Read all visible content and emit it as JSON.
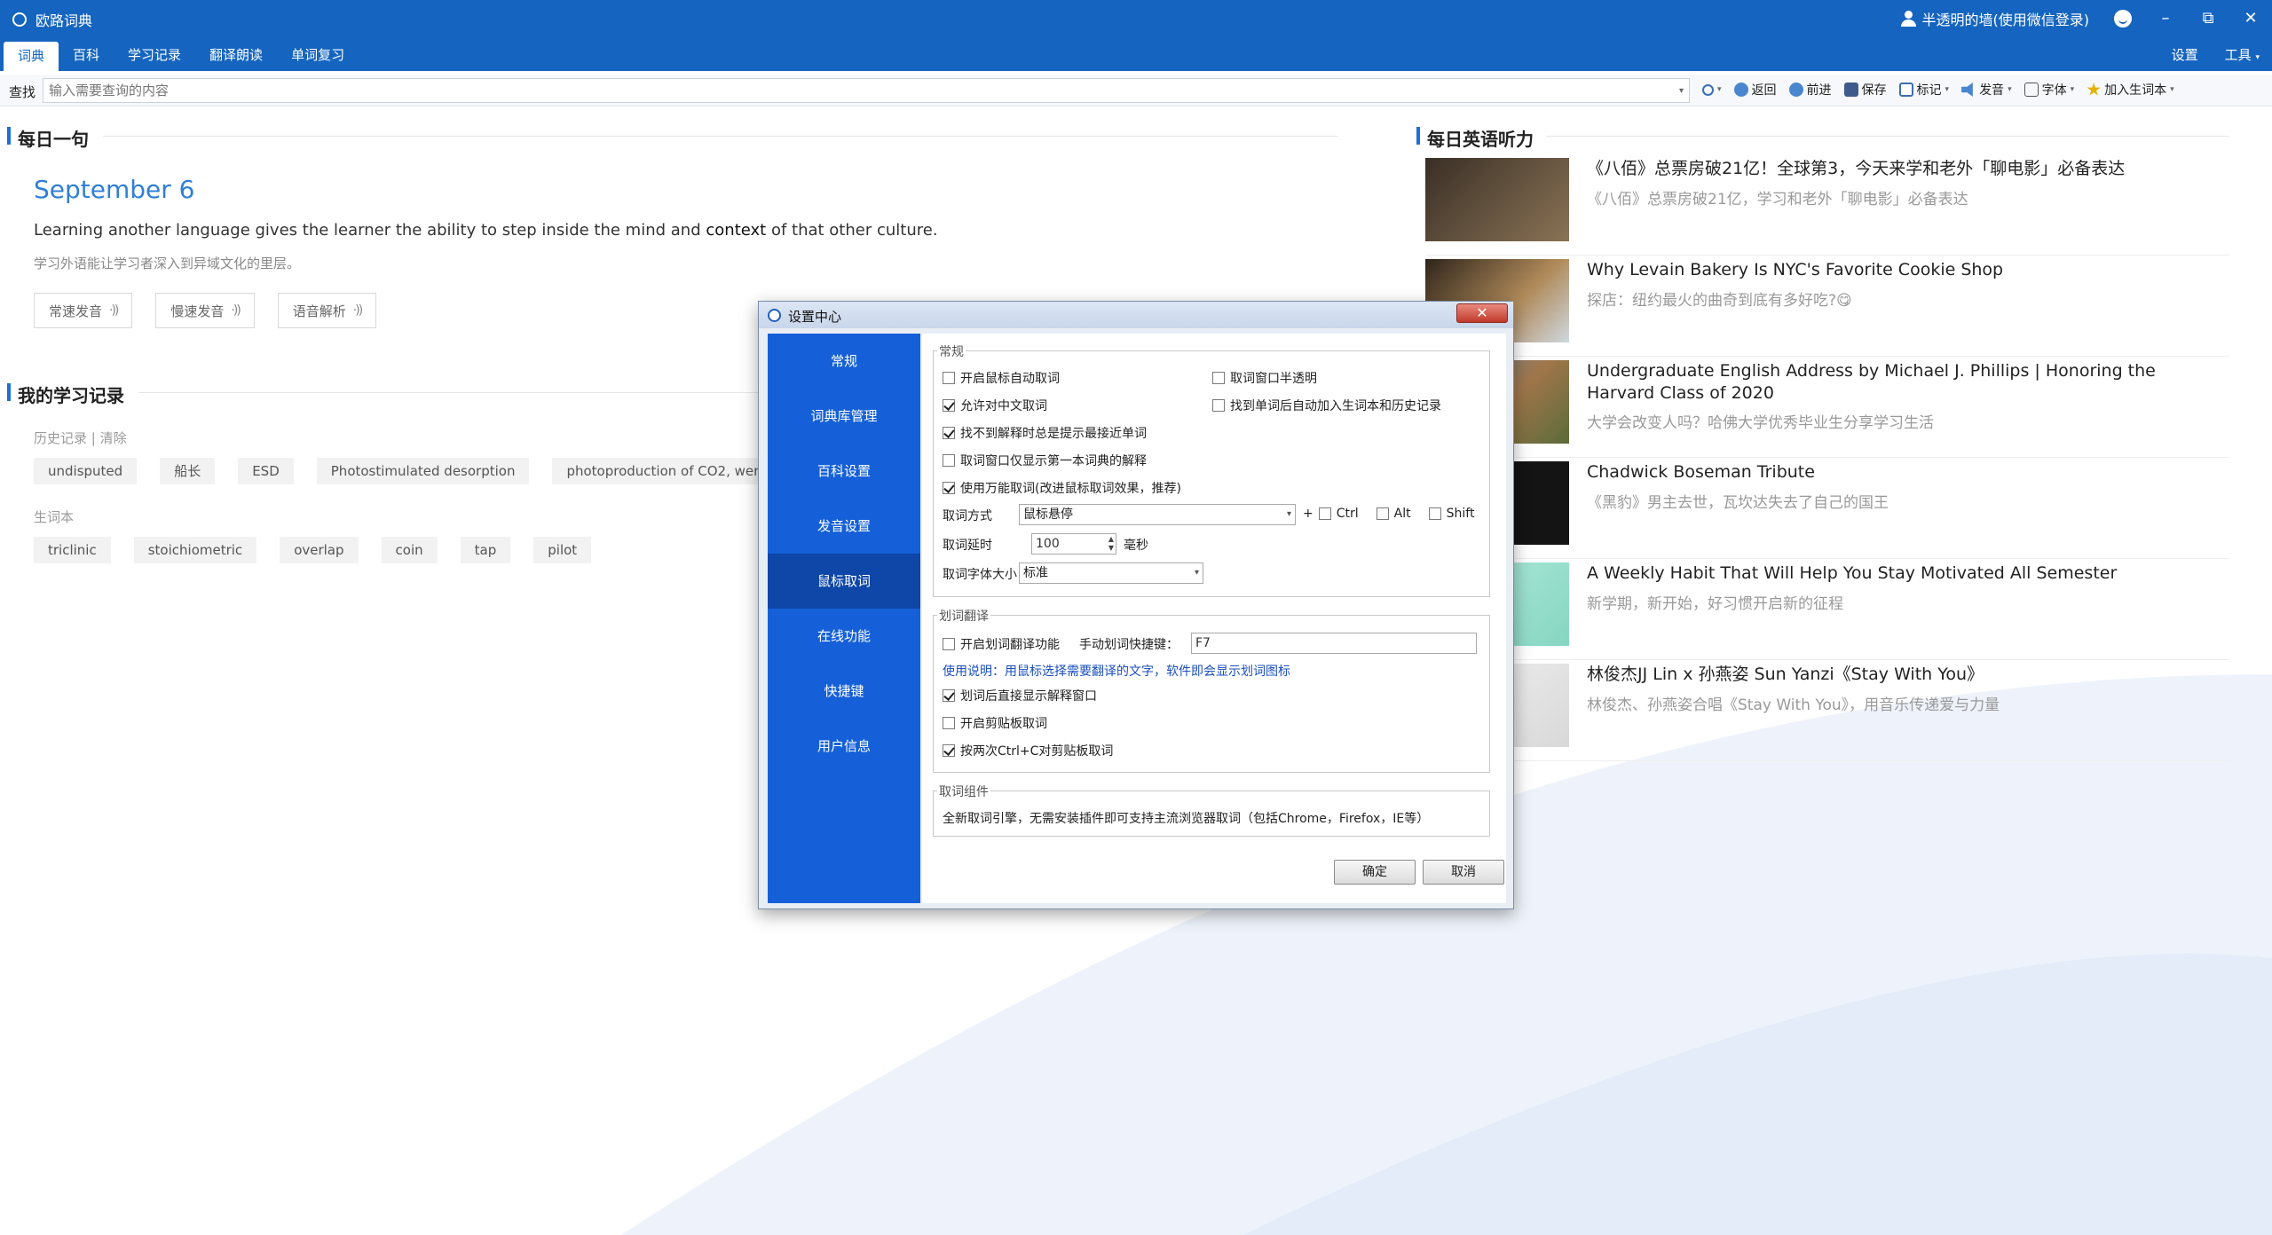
{
  "window": {
    "app_title": "欧路词典",
    "user": "半透明的墙(使用微信登录)",
    "minimize": "–",
    "restore": "⧉",
    "close": "✕"
  },
  "tabs": [
    {
      "label": "词典"
    },
    {
      "label": "百科"
    },
    {
      "label": "学习记录"
    },
    {
      "label": "翻译朗读"
    },
    {
      "label": "单词复习"
    }
  ],
  "header_right": {
    "settings": "设置",
    "tools": "工具"
  },
  "search": {
    "label": "查找",
    "placeholder": "输入需要查询的内容"
  },
  "toolbar": {
    "back": "返回",
    "forward": "前进",
    "save": "保存",
    "mark": "标记",
    "speak": "发音",
    "font": "字体",
    "add_word": "加入生词本"
  },
  "daily_sentence": {
    "section_title": "每日一句",
    "date": "September 6",
    "en_before": "Learning another language gives the learner the ability to step inside the mind and ",
    "en_keyword": "context",
    "en_after": " of that other culture.",
    "zh": "学习外语能让学习者深入到异域文化的里层。",
    "buttons": [
      "常速发音",
      "慢速发音",
      "语音解析"
    ]
  },
  "study": {
    "section_title": "我的学习记录",
    "history_label": "历史记录",
    "clear_label": "清除",
    "history": [
      "undisputed",
      "船长",
      "ESD",
      "Photostimulated desorption",
      "photoproduction of CO2, were o"
    ],
    "wordbook_label": "生词本",
    "wordbook": [
      "triclinic",
      "stoichiometric",
      "overlap",
      "coin",
      "tap",
      "pilot"
    ]
  },
  "listening": {
    "section_title": "每日英语听力",
    "items": [
      {
        "title": "《八佰》总票房破21亿！全球第3，今天来学和老外「聊电影」必备表达",
        "subtitle": "《八佰》总票房破21亿，学习和老外「聊电影」必备表达",
        "thumb_color": "#5b4a3a"
      },
      {
        "title": "Why Levain Bakery Is NYC's Favorite Cookie Shop",
        "subtitle": "探店：纽约最火的曲奇到底有多好吃?😋",
        "thumb_color": "#6a5134"
      },
      {
        "title": "Undergraduate English Address by Michael J. Phillips | Honoring the Harvard Class of 2020",
        "subtitle": "大学会改变人吗？哈佛大学优秀毕业生分享学习生活",
        "thumb_color": "#8a6b3f"
      },
      {
        "title": "Chadwick Boseman Tribute",
        "subtitle": "《黑豹》男主去世，瓦坎达失去了自己的国王",
        "thumb_color": "#161616"
      },
      {
        "title": "A Weekly Habit That Will Help You Stay Motivated All Semester",
        "subtitle": "新学期，新开始，好习惯开启新的征程",
        "thumb_color": "#9fe0cf"
      },
      {
        "title": "林俊杰JJ Lin x 孙燕姿 Sun Yanzi《Stay With You》",
        "subtitle": "林俊杰、孙燕姿合唱《Stay With You》，用音乐传递爱与力量",
        "thumb_color": "#e8e8e8"
      }
    ]
  },
  "dialog": {
    "title": "设置中心",
    "close": "✕",
    "nav": [
      "常规",
      "词典库管理",
      "百科设置",
      "发音设置",
      "鼠标取词",
      "在线功能",
      "快捷键",
      "用户信息"
    ],
    "group_general": {
      "legend": "常规",
      "options": [
        {
          "label": "开启鼠标自动取词",
          "checked": false
        },
        {
          "label": "取词窗口半透明",
          "checked": false
        },
        {
          "label": "允许对中文取词",
          "checked": true
        },
        {
          "label": "找到单词后自动加入生词本和历史记录",
          "checked": false
        },
        {
          "label": "找不到解释时总是提示最接近单词",
          "checked": true
        },
        {
          "label": "取词窗口仅显示第一本词典的解释",
          "checked": false
        },
        {
          "label": "使用万能取词(改进鼠标取词效果，推荐)",
          "checked": true
        }
      ],
      "method_label": "取词方式",
      "method_value": "鼠标悬停",
      "plus": "+",
      "ctrl": "Ctrl",
      "alt": "Alt",
      "shift": "Shift",
      "delay_label": "取词延时",
      "delay_value": "100",
      "delay_unit": "毫秒",
      "fontsize_label": "取词字体大小",
      "fontsize_value": "标准"
    },
    "group_translate": {
      "legend": "划词翻译",
      "enable_label": "开启划词翻译功能",
      "hotkey_label": "手动划词快捷键：",
      "hotkey_value": "F7",
      "hint": "使用说明：用鼠标选择需要翻译的文字，软件即会显示划词图标",
      "options": [
        {
          "label": "划词后直接显示解释窗口",
          "checked": true
        },
        {
          "label": "开启剪贴板取词",
          "checked": false
        },
        {
          "label": "按两次Ctrl+C对剪贴板取词",
          "checked": true
        }
      ]
    },
    "group_component": {
      "legend": "取词组件",
      "text": "全新取词引擎，无需安装插件即可支持主流浏览器取词（包括Chrome，Firefox，IE等）"
    },
    "ok": "确定",
    "cancel": "取消"
  }
}
